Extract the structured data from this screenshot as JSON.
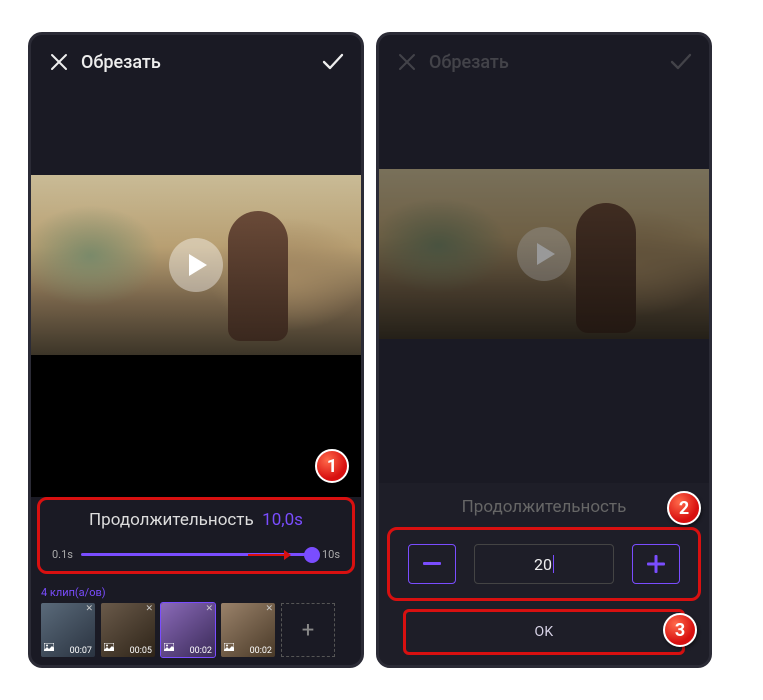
{
  "left": {
    "header": {
      "title": "Обрезать"
    },
    "duration": {
      "label": "Продолжительность",
      "value": "10,0s",
      "min": "0.1s",
      "max": "10s"
    },
    "clips": {
      "label": "4 клип(а/ов)",
      "items": [
        {
          "time": "00:07"
        },
        {
          "time": "00:05"
        },
        {
          "time": "00:02"
        },
        {
          "time": "00:02"
        }
      ]
    },
    "badge": "1"
  },
  "right": {
    "header": {
      "title": "Обрезать"
    },
    "duration_label": "Продолжительность",
    "stepper": {
      "value": "20"
    },
    "ok_label": "OK",
    "badge_stepper": "2",
    "badge_ok": "3"
  }
}
